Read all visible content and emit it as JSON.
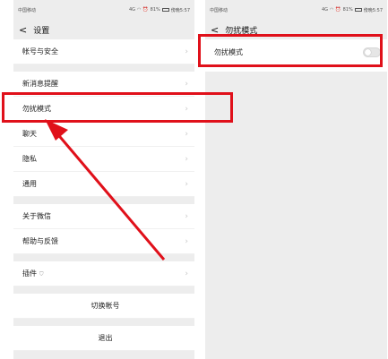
{
  "status_bar": {
    "carrier": "中国移动",
    "network": "4G",
    "battery": "81%",
    "time": "傍晚5:57"
  },
  "left_screen": {
    "title": "设置",
    "items": [
      {
        "label": "帐号与安全"
      },
      {
        "label": "新消息提醒"
      },
      {
        "label": "勿扰模式"
      },
      {
        "label": "聊天"
      },
      {
        "label": "隐私"
      },
      {
        "label": "通用"
      },
      {
        "label": "关于微信"
      },
      {
        "label": "帮助与反馈"
      },
      {
        "label": "插件"
      }
    ],
    "switch_account": "切换帐号",
    "logout": "退出"
  },
  "right_screen": {
    "title": "勿扰模式",
    "toggle_label": "勿扰模式",
    "toggle_on": false
  },
  "colors": {
    "highlight": "#e0101a",
    "background": "#ededed"
  }
}
